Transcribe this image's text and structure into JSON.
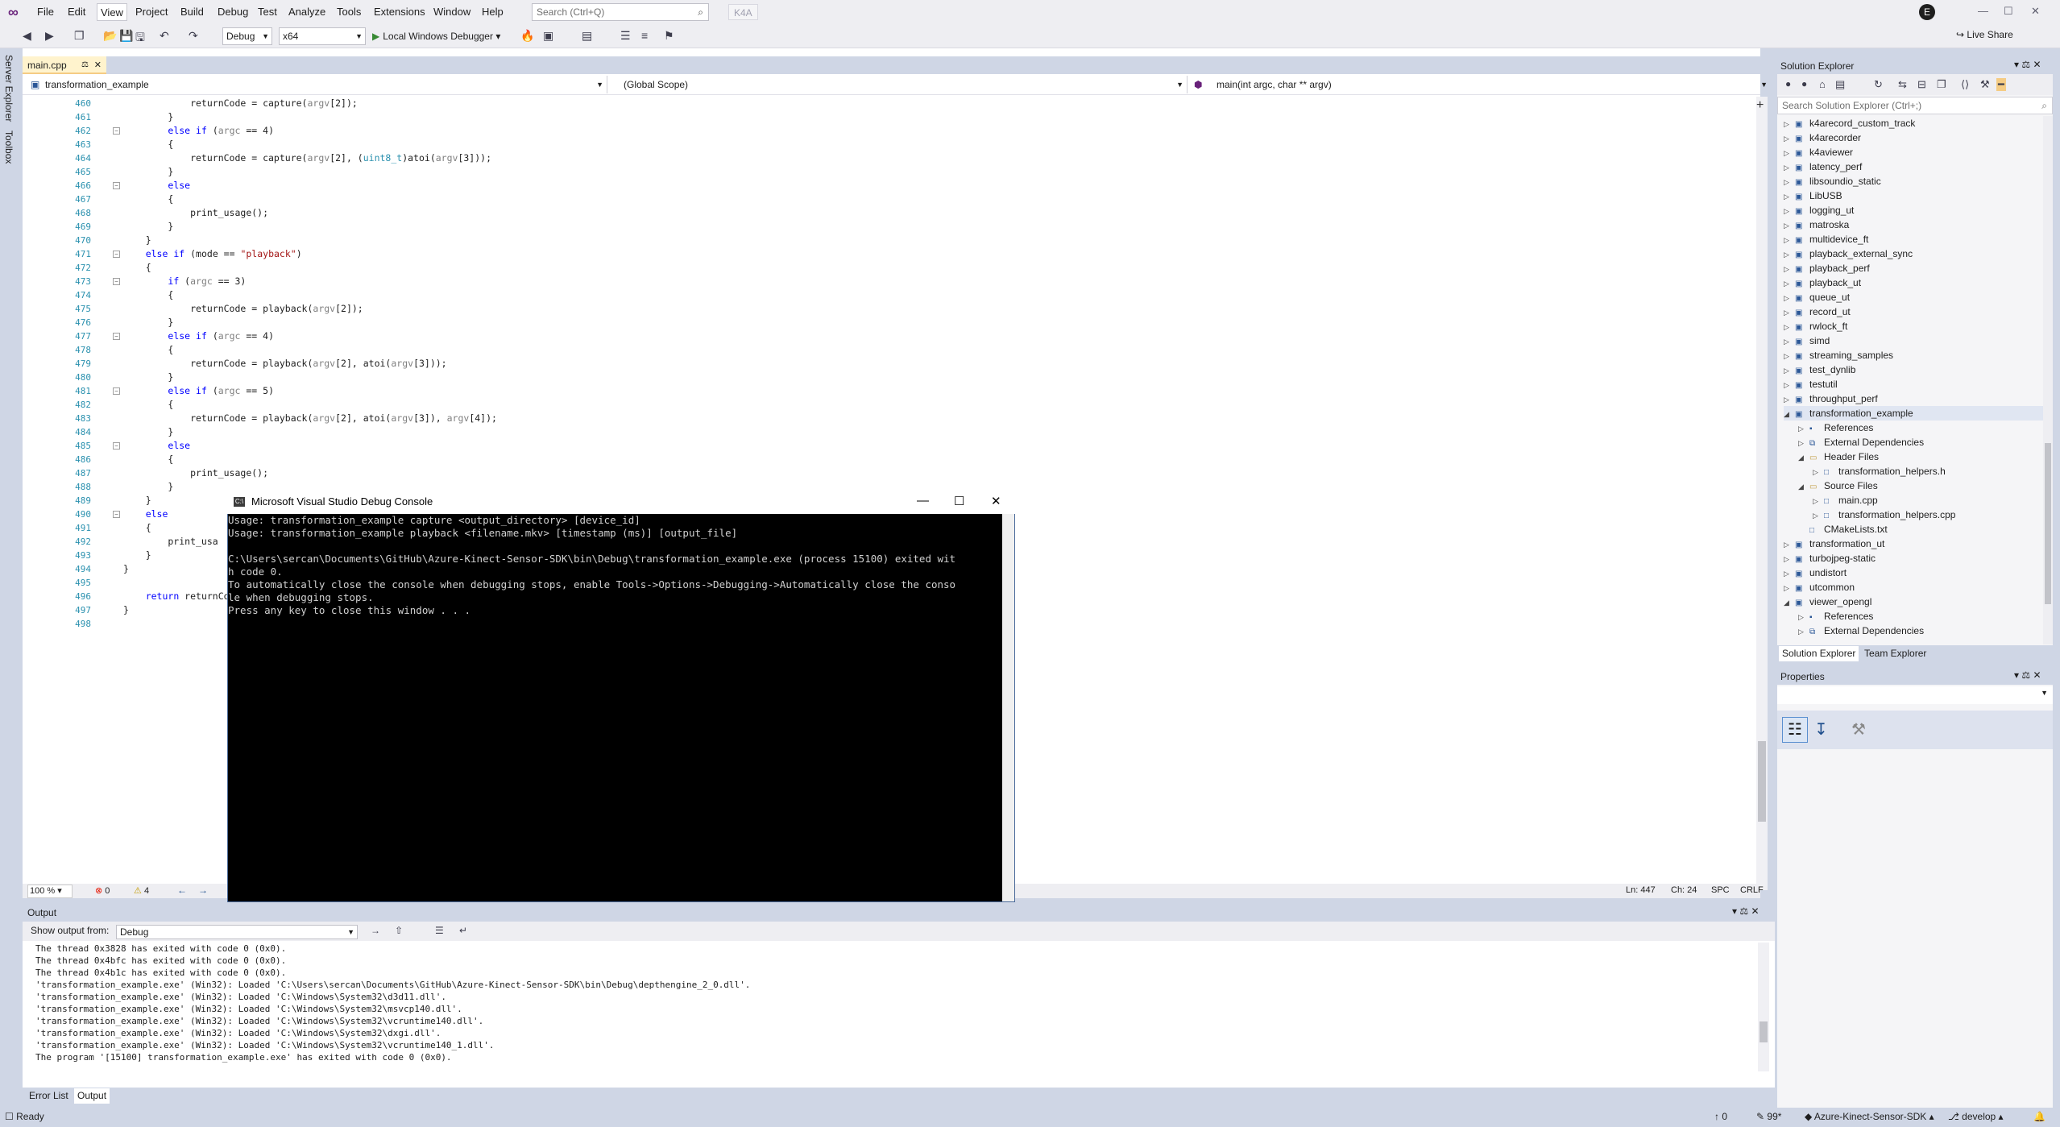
{
  "menubar": {
    "items": [
      "File",
      "Edit",
      "View",
      "Project",
      "Build",
      "Debug",
      "Test",
      "Analyze",
      "Tools",
      "Extensions",
      "Window",
      "Help"
    ],
    "active": "View",
    "search_placeholder": "Search (Ctrl+Q)",
    "solution_badge": "K4A",
    "avatar_initial": "E"
  },
  "toolbar": {
    "config": "Debug",
    "platform": "x64",
    "run_label": "Local Windows Debugger",
    "live_share": "Live Share"
  },
  "side_tabs": [
    "Server Explorer",
    "Toolbox"
  ],
  "editor": {
    "tab_label": "main.cpp",
    "nav_project": "transformation_example",
    "nav_scope": "(Global Scope)",
    "nav_member": "main(int argc, char ** argv)",
    "lines": [
      {
        "n": "460",
        "code": "            returnCode = capture(argv[2]);"
      },
      {
        "n": "461",
        "code": "        }"
      },
      {
        "n": "462",
        "code": "        else if (argc == 4)"
      },
      {
        "n": "463",
        "code": "        {"
      },
      {
        "n": "464",
        "code": "            returnCode = capture(argv[2], (uint8_t)atoi(argv[3]));"
      },
      {
        "n": "465",
        "code": "        }"
      },
      {
        "n": "466",
        "code": "        else"
      },
      {
        "n": "467",
        "code": "        {"
      },
      {
        "n": "468",
        "code": "            print_usage();"
      },
      {
        "n": "469",
        "code": "        }"
      },
      {
        "n": "470",
        "code": "    }"
      },
      {
        "n": "471",
        "code": "    else if (mode == \"playback\")"
      },
      {
        "n": "472",
        "code": "    {"
      },
      {
        "n": "473",
        "code": "        if (argc == 3)"
      },
      {
        "n": "474",
        "code": "        {"
      },
      {
        "n": "475",
        "code": "            returnCode = playback(argv[2]);"
      },
      {
        "n": "476",
        "code": "        }"
      },
      {
        "n": "477",
        "code": "        else if (argc == 4)"
      },
      {
        "n": "478",
        "code": "        {"
      },
      {
        "n": "479",
        "code": "            returnCode = playback(argv[2], atoi(argv[3]));"
      },
      {
        "n": "480",
        "code": "        }"
      },
      {
        "n": "481",
        "code": "        else if (argc == 5)"
      },
      {
        "n": "482",
        "code": "        {"
      },
      {
        "n": "483",
        "code": "            returnCode = playback(argv[2], atoi(argv[3]), argv[4]);"
      },
      {
        "n": "484",
        "code": "        }"
      },
      {
        "n": "485",
        "code": "        else"
      },
      {
        "n": "486",
        "code": "        {"
      },
      {
        "n": "487",
        "code": "            print_usage();"
      },
      {
        "n": "488",
        "code": "        }"
      },
      {
        "n": "489",
        "code": "    }"
      },
      {
        "n": "490",
        "code": "    else"
      },
      {
        "n": "491",
        "code": "    {"
      },
      {
        "n": "492",
        "code": "        print_usa"
      },
      {
        "n": "493",
        "code": "    }"
      },
      {
        "n": "494",
        "code": "}"
      },
      {
        "n": "495",
        "code": ""
      },
      {
        "n": "496",
        "code": "    return returnCode"
      },
      {
        "n": "497",
        "code": "}"
      },
      {
        "n": "498",
        "code": ""
      }
    ],
    "status": {
      "zoom": "100 %",
      "errors": "0",
      "warnings": "4",
      "ln": "Ln: 447",
      "ch": "Ch: 24",
      "spc": "SPC",
      "crlf": "CRLF"
    }
  },
  "console": {
    "title": "Microsoft Visual Studio Debug Console",
    "lines": [
      "Usage: transformation_example capture <output_directory> [device_id]",
      "Usage: transformation_example playback <filename.mkv> [timestamp (ms)] [output_file]",
      "",
      "C:\\Users\\sercan\\Documents\\GitHub\\Azure-Kinect-Sensor-SDK\\bin\\Debug\\transformation_example.exe (process 15100) exited wit",
      "h code 0.",
      "To automatically close the console when debugging stops, enable Tools->Options->Debugging->Automatically close the conso",
      "le when debugging stops.",
      "Press any key to close this window . . ."
    ]
  },
  "output": {
    "title": "Output",
    "show_from_label": "Show output from:",
    "source": "Debug",
    "lines": [
      "The thread 0x3828 has exited with code 0 (0x0).",
      "The thread 0x4bfc has exited with code 0 (0x0).",
      "The thread 0x4b1c has exited with code 0 (0x0).",
      "'transformation_example.exe' (Win32): Loaded 'C:\\Users\\sercan\\Documents\\GitHub\\Azure-Kinect-Sensor-SDK\\bin\\Debug\\depthengine_2_0.dll'.",
      "'transformation_example.exe' (Win32): Loaded 'C:\\Windows\\System32\\d3d11.dll'.",
      "'transformation_example.exe' (Win32): Loaded 'C:\\Windows\\System32\\msvcp140.dll'.",
      "'transformation_example.exe' (Win32): Loaded 'C:\\Windows\\System32\\vcruntime140.dll'.",
      "'transformation_example.exe' (Win32): Loaded 'C:\\Windows\\System32\\dxgi.dll'.",
      "'transformation_example.exe' (Win32): Loaded 'C:\\Windows\\System32\\vcruntime140_1.dll'.",
      "The program '[15100] transformation_example.exe' has exited with code 0 (0x0)."
    ],
    "tabs": [
      "Error List",
      "Output"
    ]
  },
  "solution_explorer": {
    "title": "Solution Explorer",
    "search_placeholder": "Search Solution Explorer (Ctrl+;)",
    "items": [
      {
        "label": "k4arecord_custom_track",
        "depth": 0,
        "exp": "collapsed"
      },
      {
        "label": "k4arecorder",
        "depth": 0,
        "exp": "collapsed"
      },
      {
        "label": "k4aviewer",
        "depth": 0,
        "exp": "collapsed"
      },
      {
        "label": "latency_perf",
        "depth": 0,
        "exp": "collapsed"
      },
      {
        "label": "libsoundio_static",
        "depth": 0,
        "exp": "collapsed"
      },
      {
        "label": "LibUSB",
        "depth": 0,
        "exp": "collapsed"
      },
      {
        "label": "logging_ut",
        "depth": 0,
        "exp": "collapsed"
      },
      {
        "label": "matroska",
        "depth": 0,
        "exp": "collapsed"
      },
      {
        "label": "multidevice_ft",
        "depth": 0,
        "exp": "collapsed"
      },
      {
        "label": "playback_external_sync",
        "depth": 0,
        "exp": "collapsed"
      },
      {
        "label": "playback_perf",
        "depth": 0,
        "exp": "collapsed"
      },
      {
        "label": "playback_ut",
        "depth": 0,
        "exp": "collapsed"
      },
      {
        "label": "queue_ut",
        "depth": 0,
        "exp": "collapsed"
      },
      {
        "label": "record_ut",
        "depth": 0,
        "exp": "collapsed"
      },
      {
        "label": "rwlock_ft",
        "depth": 0,
        "exp": "collapsed"
      },
      {
        "label": "simd",
        "depth": 0,
        "exp": "collapsed"
      },
      {
        "label": "streaming_samples",
        "depth": 0,
        "exp": "collapsed"
      },
      {
        "label": "test_dynlib",
        "depth": 0,
        "exp": "collapsed"
      },
      {
        "label": "testutil",
        "depth": 0,
        "exp": "collapsed"
      },
      {
        "label": "throughput_perf",
        "depth": 0,
        "exp": "collapsed"
      },
      {
        "label": "transformation_example",
        "depth": 0,
        "exp": "expanded"
      },
      {
        "label": "References",
        "depth": 1,
        "exp": "collapsed"
      },
      {
        "label": "External Dependencies",
        "depth": 1,
        "exp": "collapsed"
      },
      {
        "label": "Header Files",
        "depth": 1,
        "exp": "expanded"
      },
      {
        "label": "transformation_helpers.h",
        "depth": 2,
        "exp": "collapsed"
      },
      {
        "label": "Source Files",
        "depth": 1,
        "exp": "expanded"
      },
      {
        "label": "main.cpp",
        "depth": 2,
        "exp": "collapsed"
      },
      {
        "label": "transformation_helpers.cpp",
        "depth": 2,
        "exp": "collapsed"
      },
      {
        "label": "CMakeLists.txt",
        "depth": 1,
        "exp": "none"
      },
      {
        "label": "transformation_ut",
        "depth": 0,
        "exp": "collapsed"
      },
      {
        "label": "turbojpeg-static",
        "depth": 0,
        "exp": "collapsed"
      },
      {
        "label": "undistort",
        "depth": 0,
        "exp": "collapsed"
      },
      {
        "label": "utcommon",
        "depth": 0,
        "exp": "collapsed"
      },
      {
        "label": "viewer_opengl",
        "depth": 0,
        "exp": "expanded"
      },
      {
        "label": "References",
        "depth": 1,
        "exp": "collapsed"
      },
      {
        "label": "External Dependencies",
        "depth": 1,
        "exp": "collapsed"
      }
    ],
    "tabs": [
      "Solution Explorer",
      "Team Explorer"
    ]
  },
  "properties": {
    "title": "Properties"
  },
  "statusbar": {
    "ready": "Ready",
    "up_count": "0",
    "edits": "99*",
    "repo": "Azure-Kinect-Sensor-SDK",
    "branch": "develop"
  },
  "colors": {
    "accent": "#68217a",
    "chrome": "#cfd6e5",
    "keyword": "#0000ff",
    "string": "#a31515",
    "type": "#2b91af"
  }
}
